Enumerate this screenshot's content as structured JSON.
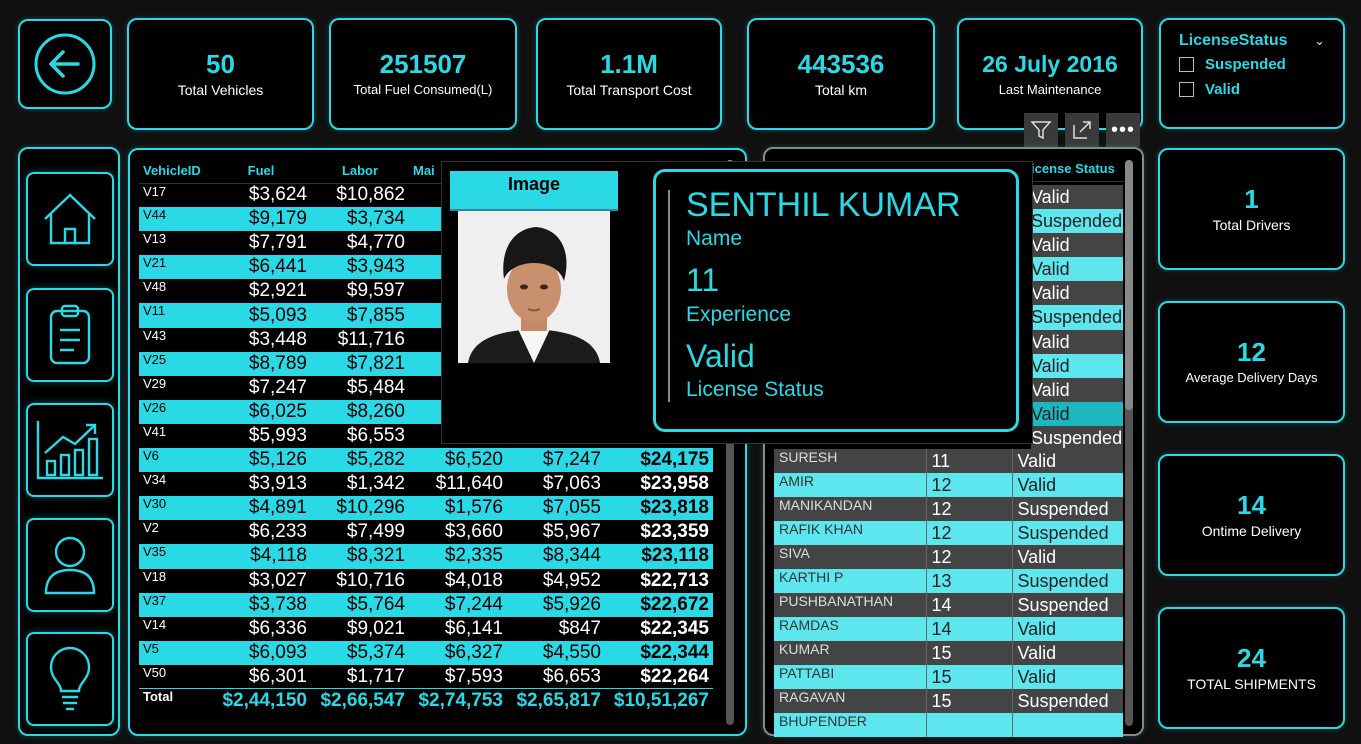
{
  "kpis": [
    {
      "value": "50",
      "label": "Total Vehicles"
    },
    {
      "value": "251507",
      "label": "Total Fuel Consumed(L)"
    },
    {
      "value": "1.1M",
      "label": "Total Transport Cost"
    },
    {
      "value": "443536",
      "label": "Total km"
    },
    {
      "value": "26 July 2016",
      "label": "Last Maintenance"
    }
  ],
  "right_kpis": [
    {
      "value": "1",
      "label": "Total Drivers"
    },
    {
      "value": "12",
      "label": "Average Delivery Days"
    },
    {
      "value": "14",
      "label": "Ontime Delivery"
    },
    {
      "value": "24",
      "label": "TOTAL SHIPMENTS"
    }
  ],
  "slicer": {
    "title": "LicenseStatus",
    "options": [
      "Suspended",
      "Valid"
    ]
  },
  "vehicle_table": {
    "columns": [
      "VehicleID",
      "Fuel",
      "Labor",
      "Mai"
    ],
    "rows": [
      {
        "id": "V17",
        "fuel": "$3,624",
        "labor": "$10,862",
        "maint": "",
        "other": "",
        "total": "",
        "style": "k"
      },
      {
        "id": "V44",
        "fuel": "$9,179",
        "labor": "$3,734",
        "maint": "",
        "other": "",
        "total": "",
        "style": "c"
      },
      {
        "id": "V13",
        "fuel": "$7,791",
        "labor": "$4,770",
        "maint": "",
        "other": "",
        "total": "",
        "style": "k"
      },
      {
        "id": "V21",
        "fuel": "$6,441",
        "labor": "$3,943",
        "maint": "",
        "other": "",
        "total": "",
        "style": "c"
      },
      {
        "id": "V48",
        "fuel": "$2,921",
        "labor": "$9,597",
        "maint": "",
        "other": "",
        "total": "",
        "style": "k"
      },
      {
        "id": "V11",
        "fuel": "$5,093",
        "labor": "$7,855",
        "maint": "",
        "other": "",
        "total": "",
        "style": "c"
      },
      {
        "id": "V43",
        "fuel": "$3,448",
        "labor": "$11,716",
        "maint": "",
        "other": "",
        "total": "",
        "style": "k"
      },
      {
        "id": "V25",
        "fuel": "$8,789",
        "labor": "$7,821",
        "maint": "",
        "other": "",
        "total": "",
        "style": "c"
      },
      {
        "id": "V29",
        "fuel": "$7,247",
        "labor": "$5,484",
        "maint": "",
        "other": "",
        "total": "",
        "style": "k"
      },
      {
        "id": "V26",
        "fuel": "$6,025",
        "labor": "$8,260",
        "maint": "",
        "other": "",
        "total": "",
        "style": "c"
      },
      {
        "id": "V41",
        "fuel": "$5,993",
        "labor": "$6,553",
        "maint": "",
        "other": "",
        "total": "",
        "style": "k"
      },
      {
        "id": "V6",
        "fuel": "$5,126",
        "labor": "$5,282",
        "maint": "$6,520",
        "other": "$7,247",
        "total": "$24,175",
        "style": "c"
      },
      {
        "id": "V34",
        "fuel": "$3,913",
        "labor": "$1,342",
        "maint": "$11,640",
        "other": "$7,063",
        "total": "$23,958",
        "style": "k"
      },
      {
        "id": "V30",
        "fuel": "$4,891",
        "labor": "$10,296",
        "maint": "$1,576",
        "other": "$7,055",
        "total": "$23,818",
        "style": "c"
      },
      {
        "id": "V2",
        "fuel": "$6,233",
        "labor": "$7,499",
        "maint": "$3,660",
        "other": "$5,967",
        "total": "$23,359",
        "style": "k"
      },
      {
        "id": "V35",
        "fuel": "$4,118",
        "labor": "$8,321",
        "maint": "$2,335",
        "other": "$8,344",
        "total": "$23,118",
        "style": "c"
      },
      {
        "id": "V18",
        "fuel": "$3,027",
        "labor": "$10,716",
        "maint": "$4,018",
        "other": "$4,952",
        "total": "$22,713",
        "style": "k"
      },
      {
        "id": "V37",
        "fuel": "$3,738",
        "labor": "$5,764",
        "maint": "$7,244",
        "other": "$5,926",
        "total": "$22,672",
        "style": "c"
      },
      {
        "id": "V14",
        "fuel": "$6,336",
        "labor": "$9,021",
        "maint": "$6,141",
        "other": "$847",
        "total": "$22,345",
        "style": "k"
      },
      {
        "id": "V5",
        "fuel": "$6,093",
        "labor": "$5,374",
        "maint": "$6,327",
        "other": "$4,550",
        "total": "$22,344",
        "style": "c"
      },
      {
        "id": "V50",
        "fuel": "$6,301",
        "labor": "$1,717",
        "maint": "$7,593",
        "other": "$6,653",
        "total": "$22,264",
        "style": "k"
      }
    ],
    "total": {
      "id": "Total",
      "fuel": "$2,44,150",
      "labor": "$2,66,547",
      "maint": "$2,74,753",
      "other": "$2,65,817",
      "total": "$10,51,267"
    }
  },
  "driver_table": {
    "header_fragment": "icense Status",
    "partial_rows": [
      {
        "status": "Valid",
        "style": "g"
      },
      {
        "status": "Suspended",
        "style": "c"
      },
      {
        "status": "Valid",
        "style": "g"
      },
      {
        "status": "Valid",
        "style": "c"
      },
      {
        "status": "Valid",
        "style": "g"
      },
      {
        "status": "Suspended",
        "style": "c"
      },
      {
        "status": "Valid",
        "style": "g"
      },
      {
        "status": "Valid",
        "style": "c"
      },
      {
        "status": "Valid",
        "style": "g"
      },
      {
        "status": "Valid",
        "style": "sel"
      },
      {
        "status": "Suspended",
        "style": "g",
        "exp": "11"
      }
    ],
    "rows": [
      {
        "name": "SURESH",
        "exp": "11",
        "status": "Valid",
        "style": "g"
      },
      {
        "name": "AMIR",
        "exp": "12",
        "status": "Valid",
        "style": "c"
      },
      {
        "name": "MANIKANDAN",
        "exp": "12",
        "status": "Suspended",
        "style": "g"
      },
      {
        "name": "RAFIK KHAN",
        "exp": "12",
        "status": "Suspended",
        "style": "c"
      },
      {
        "name": "SIVA",
        "exp": "12",
        "status": "Valid",
        "style": "g"
      },
      {
        "name": "KARTHI P",
        "exp": "13",
        "status": "Suspended",
        "style": "c"
      },
      {
        "name": "PUSHBANATHAN",
        "exp": "14",
        "status": "Suspended",
        "style": "g"
      },
      {
        "name": "RAMDAS",
        "exp": "14",
        "status": "Valid",
        "style": "c"
      },
      {
        "name": "KUMAR",
        "exp": "15",
        "status": "Valid",
        "style": "g"
      },
      {
        "name": "PATTABI",
        "exp": "15",
        "status": "Valid",
        "style": "c"
      },
      {
        "name": "RAGAVAN",
        "exp": "15",
        "status": "Suspended",
        "style": "g"
      },
      {
        "name": "BHUPENDER",
        "exp": "",
        "status": "",
        "style": "c"
      }
    ]
  },
  "tooltip": {
    "image_header": "Image",
    "name_value": "SENTHIL KUMAR",
    "name_label": "Name",
    "exp_value": "11",
    "exp_label": "Experience",
    "lic_value": "Valid",
    "lic_label": "License Status"
  },
  "nav_icons": [
    "back-arrow-icon",
    "home-icon",
    "clipboard-icon",
    "chart-icon",
    "user-icon",
    "lightbulb-icon"
  ],
  "colors": {
    "accent": "#29d9e6",
    "row_light": "#5de6ee",
    "row_dark": "#444444",
    "background": "#000000"
  }
}
